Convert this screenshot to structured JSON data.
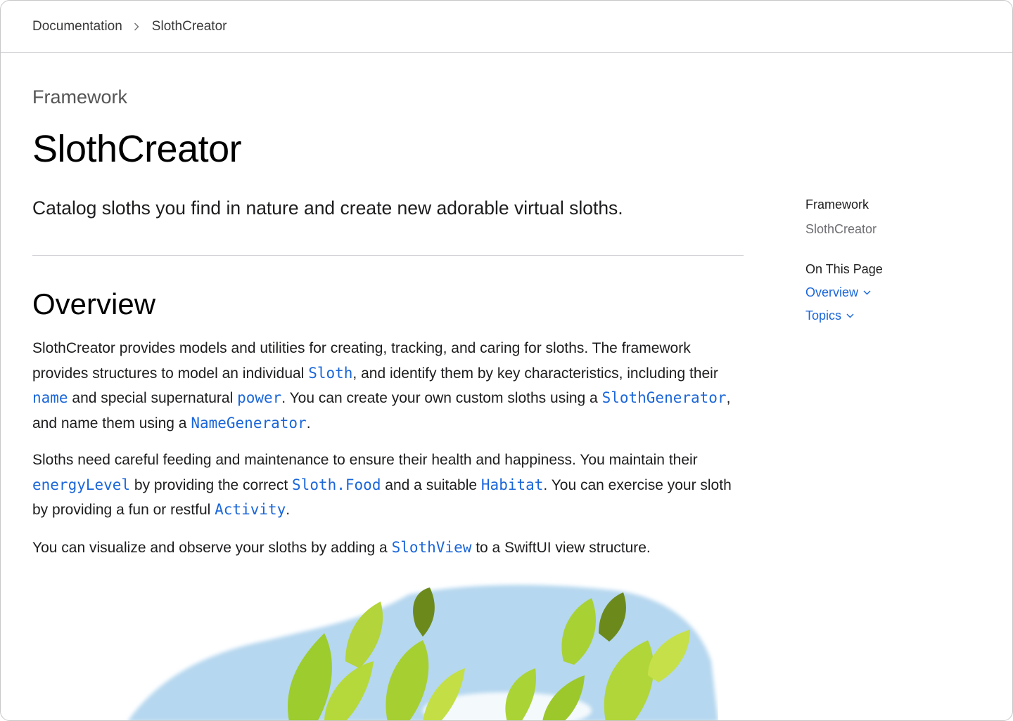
{
  "breadcrumb": {
    "items": [
      "Documentation",
      "SlothCreator"
    ]
  },
  "header": {
    "eyebrow": "Framework",
    "title": "SlothCreator",
    "abstract": "Catalog sloths you find in nature and create new adorable virtual sloths."
  },
  "overview": {
    "heading": "Overview",
    "p1": {
      "t1": "SlothCreator provides models and utilities for creating, tracking, and caring for sloths. The framework provides structures to model an individual ",
      "c1": "Sloth",
      "t2": ", and identify them by key characteristics, including their ",
      "c2": "name",
      "t3": " and special supernatural ",
      "c3": "power",
      "t4": ". You can create your own custom sloths using a ",
      "c4": "SlothGenerator",
      "t5": ", and name them using a ",
      "c5": "NameGenerator",
      "t6": "."
    },
    "p2": {
      "t1": "Sloths need careful feeding and maintenance to ensure their health and happiness. You maintain their ",
      "c1": "energyLevel",
      "t2": " by providing the correct ",
      "c2": "Sloth.Food",
      "t3": " and a suitable ",
      "c3": "Habitat",
      "t4": ". You can exercise your sloth by providing a fun or restful ",
      "c4": "Activity",
      "t5": "."
    },
    "p3": {
      "t1": "You can visualize and observe your sloths by adding a ",
      "c1": "SlothView",
      "t2": " to a SwiftUI view structure."
    }
  },
  "sidebar": {
    "kind": "Framework",
    "name": "SlothCreator",
    "on_this_page": "On This Page",
    "links": [
      "Overview",
      "Topics"
    ]
  },
  "colors": {
    "link": "#1a66d9",
    "divider": "#d2d2d7"
  }
}
